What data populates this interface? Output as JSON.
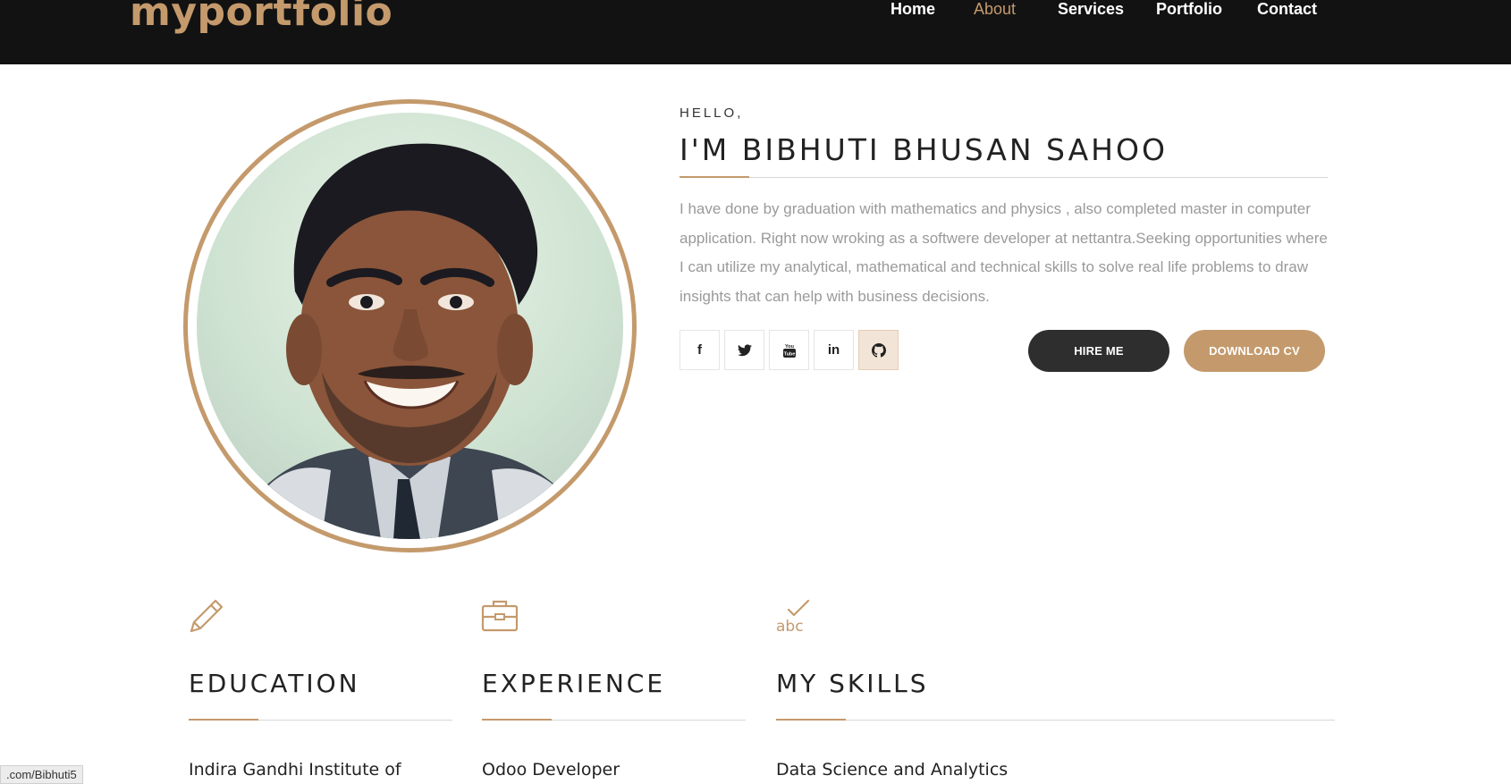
{
  "brand": {
    "logo": "myportfolio"
  },
  "nav": {
    "items": [
      "Home",
      "About",
      "Services",
      "Portfolio",
      "Contact"
    ],
    "active": "About"
  },
  "intro": {
    "greeting": "HELLO,",
    "name": "I'M BIBHUTI BHUSAN SAHOO",
    "bio": "I have done by graduation with mathematics and physics , also completed master in computer application. Right now wroking as a softwere developer at nettantra.Seeking opportunities where I can utilize my analytical, mathematical and technical skills to solve real life problems to draw insights that can help with business decisions."
  },
  "social": [
    {
      "icon": "facebook-icon",
      "glyph": "f"
    },
    {
      "icon": "twitter-icon",
      "glyph": "🐦"
    },
    {
      "icon": "youtube-icon",
      "glyph": "▶"
    },
    {
      "icon": "linkedin-icon",
      "glyph": "in"
    },
    {
      "icon": "github-icon",
      "glyph": "⌥"
    }
  ],
  "buttons": {
    "hire": "HIRE ME",
    "download": "DOWNLOAD CV"
  },
  "features": [
    {
      "icon": "pencil-icon",
      "title": "EDUCATION",
      "first_item": "Indira Gandhi Institute of"
    },
    {
      "icon": "briefcase-icon",
      "title": "EXPERIENCE",
      "first_item": "Odoo Developer"
    },
    {
      "icon": "abc-check-icon",
      "title": "MY SKILLS",
      "first_item": "Data Science and Analytics"
    }
  ],
  "status_url": ".com/Bibhuti5",
  "colors": {
    "accent": "#c49a6c",
    "nav_bg": "#121212",
    "dark_button": "#2e2e2e",
    "muted_text": "#9a9a9a"
  }
}
